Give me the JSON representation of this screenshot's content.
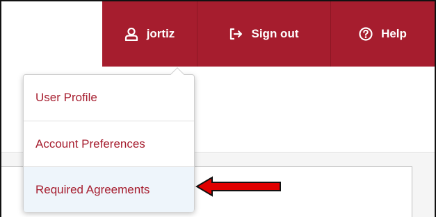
{
  "header": {
    "username": "jortiz",
    "signout_label": "Sign out",
    "help_label": "Help",
    "accent_color": "#a61d2e"
  },
  "icons": {
    "user": "user-icon",
    "signout": "sign-out-icon",
    "help": "help-circle-icon"
  },
  "dropdown": {
    "items": [
      {
        "label": "User Profile"
      },
      {
        "label": "Account Preferences"
      },
      {
        "label": "Required Agreements",
        "highlighted": true
      }
    ]
  },
  "annotation": {
    "arrow_color": "#e00000",
    "arrow_target": "Required Agreements"
  }
}
